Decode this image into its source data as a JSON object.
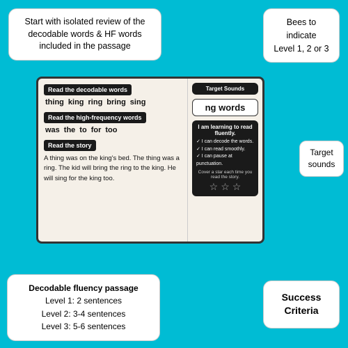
{
  "bubbles": {
    "top_left": "Start with isolated review of the decodable words & HF words included in the passage",
    "top_right_line1": "Bees to",
    "top_right_line2": "indicate",
    "top_right_line3": "Level 1, 2 or 3",
    "target_sounds_label": "Target sounds",
    "bottom_left_title": "Decodable fluency passage",
    "bottom_left_level1": "Level 1: 2 sentences",
    "bottom_left_level2": "Level 2: 3-4 sentences",
    "bottom_left_level3": "Level 3: 5-6 sentences",
    "bottom_right": "Success Criteria"
  },
  "slide": {
    "decodable_label": "Read the decodable words",
    "decodable_words": [
      "thing",
      "king",
      "ring",
      "bring",
      "sing"
    ],
    "hf_label": "Read the high-frequency words",
    "hf_words": [
      "was",
      "the",
      "to",
      "for",
      "too"
    ],
    "story_label": "Read the story",
    "story_text": "A thing was on the king's bed. The thing was a ring. The kid will bring the ring to the king. He will sing for the king too.",
    "target_sounds_header": "Target Sounds",
    "ng_words": "ng words",
    "learning_header": "I am learning to read fluently.",
    "can_do": [
      "✓ I can decode the words.",
      "✓ I can read smoothly.",
      "✓ I can pause at punctuation."
    ],
    "cover_star_text": "Cover a star each time you read the story."
  }
}
